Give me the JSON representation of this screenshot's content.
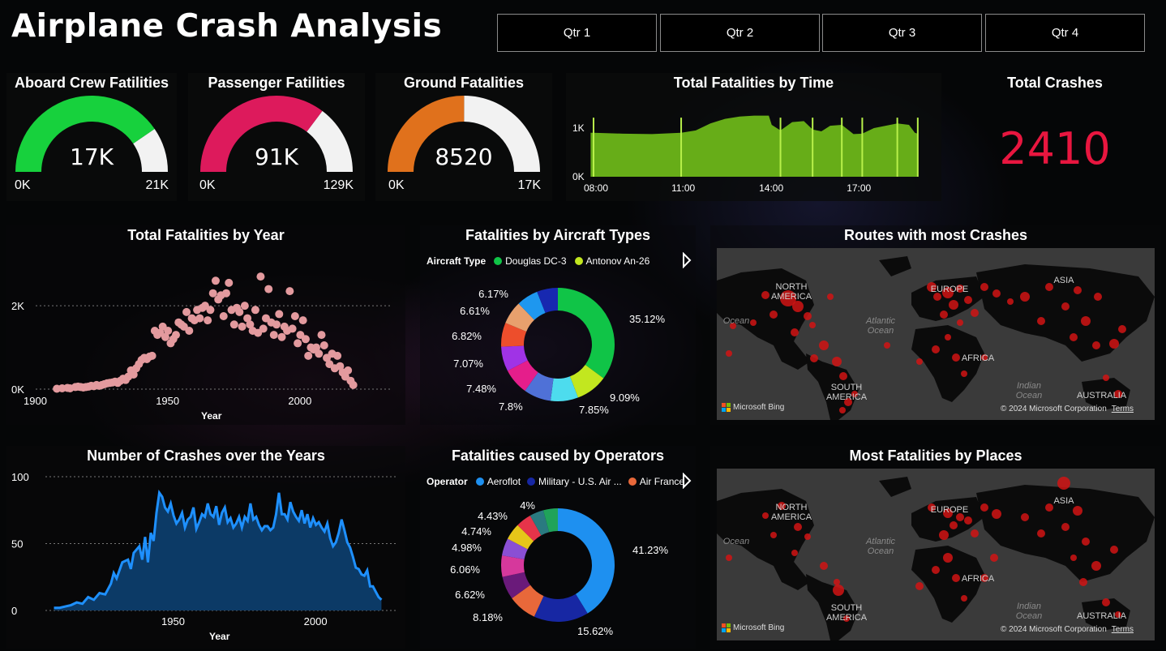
{
  "header": {
    "title": "Airplane Crash Analysis",
    "quarters": [
      "Qtr 1",
      "Qtr 2",
      "Qtr 3",
      "Qtr 4"
    ]
  },
  "gauges": [
    {
      "title": "Aboard Crew Fatilities",
      "value": 17000,
      "value_label": "17K",
      "min_label": "0K",
      "max": 21000,
      "max_label": "21K",
      "color": "#17d13d"
    },
    {
      "title": "Passenger Fatilities",
      "value": 91000,
      "value_label": "91K",
      "min_label": "0K",
      "max": 129000,
      "max_label": "129K",
      "color": "#dd1a5c"
    },
    {
      "title": "Ground Fatalities",
      "value": 8520,
      "value_label": "8520",
      "min_label": "0K",
      "max": 17000,
      "max_label": "17K",
      "color": "#e0711c"
    }
  ],
  "total_crashes": {
    "title": "Total Crashes",
    "value": "2410",
    "color": "#e8163f"
  },
  "chart_data": [
    {
      "id": "fatalities_by_time",
      "type": "area",
      "title": "Total Fatalities by Time",
      "x_ticks": [
        "08:00",
        "11:00",
        "14:00",
        "17:00"
      ],
      "y_ticks": [
        "0K",
        "1K"
      ],
      "x": [
        7.9,
        8.0,
        9.0,
        10.0,
        11.0,
        11.5,
        12.0,
        12.5,
        13.0,
        13.5,
        14.0,
        14.1,
        14.4,
        14.8,
        15.2,
        15.5,
        15.8,
        16.1,
        16.5,
        16.9,
        17.2,
        17.6,
        18.0,
        18.4,
        18.8,
        19.0,
        19.1
      ],
      "y": [
        0.95,
        0.95,
        0.93,
        0.92,
        0.95,
        1.0,
        1.15,
        1.25,
        1.3,
        1.32,
        1.32,
        1.12,
        1.0,
        1.18,
        1.2,
        1.02,
        0.98,
        1.1,
        1.12,
        0.92,
        0.93,
        1.05,
        1.1,
        1.15,
        1.12,
        0.95,
        0.93
      ],
      "ylim": [
        0,
        1.4
      ],
      "color": "#67ad18"
    },
    {
      "id": "fatalities_by_year",
      "type": "scatter",
      "title": "Total Fatalities by Year",
      "xlabel": "Year",
      "x_ticks": [
        "1900",
        "1950",
        "2000"
      ],
      "y_ticks": [
        "0K",
        "2K"
      ],
      "xlim": [
        1900,
        2025
      ],
      "ylim": [
        0,
        2.8
      ],
      "x": [
        1908,
        1910,
        1912,
        1913,
        1915,
        1916,
        1917,
        1918,
        1919,
        1920,
        1921,
        1922,
        1923,
        1924,
        1925,
        1926,
        1927,
        1928,
        1929,
        1930,
        1931,
        1932,
        1933,
        1934,
        1935,
        1936,
        1937,
        1938,
        1939,
        1940,
        1941,
        1942,
        1943,
        1944,
        1945,
        1946,
        1947,
        1948,
        1949,
        1950,
        1951,
        1952,
        1953,
        1954,
        1955,
        1956,
        1957,
        1958,
        1959,
        1960,
        1961,
        1962,
        1963,
        1964,
        1965,
        1966,
        1967,
        1968,
        1969,
        1970,
        1971,
        1972,
        1973,
        1974,
        1975,
        1976,
        1977,
        1978,
        1979,
        1980,
        1981,
        1982,
        1983,
        1984,
        1985,
        1986,
        1987,
        1988,
        1989,
        1990,
        1991,
        1992,
        1993,
        1994,
        1995,
        1996,
        1997,
        1998,
        1999,
        2000,
        2001,
        2002,
        2003,
        2004,
        2005,
        2006,
        2007,
        2008,
        2009,
        2010,
        2011,
        2012,
        2013,
        2014,
        2015,
        2016,
        2017,
        2018,
        2019,
        2020
      ],
      "y": [
        0.01,
        0.02,
        0.03,
        0.02,
        0.05,
        0.06,
        0.05,
        0.04,
        0.05,
        0.06,
        0.08,
        0.07,
        0.1,
        0.08,
        0.1,
        0.12,
        0.14,
        0.15,
        0.16,
        0.18,
        0.15,
        0.2,
        0.25,
        0.22,
        0.3,
        0.45,
        0.35,
        0.5,
        0.6,
        0.7,
        0.75,
        0.72,
        0.78,
        0.8,
        1.4,
        1.3,
        1.35,
        1.5,
        1.25,
        1.4,
        1.1,
        1.2,
        1.3,
        1.6,
        1.55,
        1.5,
        1.85,
        1.4,
        1.7,
        1.65,
        1.9,
        1.7,
        1.95,
        2.0,
        1.65,
        1.9,
        2.3,
        2.6,
        2.15,
        2.25,
        1.75,
        2.3,
        2.55,
        1.9,
        1.55,
        1.95,
        1.85,
        1.5,
        2.0,
        1.7,
        1.55,
        1.4,
        1.9,
        1.35,
        2.7,
        1.45,
        1.7,
        2.4,
        1.6,
        1.3,
        1.55,
        1.8,
        1.25,
        1.5,
        1.4,
        2.35,
        1.45,
        1.75,
        1.1,
        1.3,
        1.65,
        1.2,
        0.8,
        1.0,
        0.95,
        1.0,
        0.85,
        1.3,
        1.05,
        0.75,
        0.6,
        0.85,
        0.5,
        0.8,
        0.55,
        0.4,
        0.3,
        0.45,
        0.2,
        0.1
      ],
      "color": "#e39a9e"
    },
    {
      "id": "fatalities_by_aircraft",
      "type": "pie",
      "title": "Fatalities by Aircraft Types",
      "legend_title": "Aircraft Type",
      "legend": [
        {
          "name": "Douglas DC-3",
          "color": "#10c447"
        },
        {
          "name": "Antonov An-26",
          "color": "#c2e71f"
        }
      ],
      "values": [
        35.12,
        9.09,
        7.85,
        7.8,
        7.48,
        7.07,
        6.82,
        6.61,
        6.17
      ],
      "labels": [
        "35.12%",
        "9.09%",
        "7.85%",
        "7.8%",
        "7.48%",
        "7.07%",
        "6.82%",
        "6.61%",
        "6.17%"
      ],
      "colors": [
        "#10c447",
        "#c2e71f",
        "#4ddcee",
        "#4f71d7",
        "#e51e8b",
        "#a033e6",
        "#ed4e2c",
        "#e8a06d",
        "#1e97ef"
      ],
      "last_color": "#1728b0",
      "last_value": 5.99
    },
    {
      "id": "crashes_over_years",
      "type": "area",
      "title": "Number of Crashes over the Years",
      "xlabel": "Year",
      "x_ticks": [
        "1950",
        "2000"
      ],
      "y_ticks": [
        "0",
        "50",
        "100"
      ],
      "xlim": [
        1905,
        2028
      ],
      "ylim": [
        0,
        100
      ],
      "x": [
        1908,
        1910,
        1912,
        1914,
        1916,
        1918,
        1920,
        1922,
        1924,
        1926,
        1928,
        1929,
        1930,
        1932,
        1934,
        1935,
        1936,
        1938,
        1939,
        1940,
        1941,
        1942,
        1943,
        1944,
        1945,
        1946,
        1947,
        1948,
        1949,
        1950,
        1951,
        1952,
        1953,
        1954,
        1955,
        1956,
        1957,
        1958,
        1959,
        1960,
        1961,
        1962,
        1963,
        1964,
        1965,
        1966,
        1967,
        1968,
        1969,
        1970,
        1971,
        1972,
        1973,
        1974,
        1975,
        1976,
        1977,
        1978,
        1979,
        1980,
        1981,
        1982,
        1983,
        1984,
        1985,
        1986,
        1987,
        1988,
        1989,
        1990,
        1991,
        1992,
        1993,
        1994,
        1995,
        1996,
        1997,
        1998,
        1999,
        2000,
        2001,
        2002,
        2003,
        2004,
        2005,
        2006,
        2007,
        2008,
        2009,
        2010,
        2011,
        2012,
        2013,
        2014,
        2015,
        2016,
        2017,
        2018,
        2019,
        2020,
        2021,
        2022,
        2023
      ],
      "y": [
        2,
        2,
        3,
        4,
        6,
        5,
        10,
        8,
        13,
        12,
        20,
        28,
        24,
        36,
        38,
        31,
        43,
        48,
        38,
        55,
        36,
        58,
        52,
        73,
        88,
        85,
        77,
        74,
        80,
        71,
        65,
        68,
        73,
        62,
        68,
        70,
        77,
        61,
        66,
        72,
        70,
        80,
        72,
        70,
        78,
        64,
        73,
        77,
        66,
        69,
        62,
        65,
        70,
        62,
        70,
        67,
        80,
        68,
        70,
        64,
        60,
        63,
        63,
        60,
        62,
        72,
        88,
        72,
        72,
        68,
        81,
        74,
        70,
        67,
        75,
        65,
        72,
        62,
        69,
        64,
        66,
        62,
        59,
        65,
        54,
        48,
        51,
        58,
        68,
        60,
        51,
        47,
        40,
        32,
        31,
        27,
        26,
        30,
        18,
        18,
        14,
        10,
        8
      ],
      "color": "#1e90ff"
    },
    {
      "id": "fatalities_by_operator",
      "type": "pie",
      "title": "Fatalities caused by Operators",
      "legend_title": "Operator",
      "legend": [
        {
          "name": "Aeroflot",
          "color": "#1e90f0"
        },
        {
          "name": "Military - U.S. Air ...",
          "color": "#1727a3"
        },
        {
          "name": "Air France",
          "color": "#e8683a"
        }
      ],
      "values": [
        41.23,
        15.62,
        8.18,
        6.62,
        6.06,
        4.98,
        4.74,
        4.43,
        4,
        4.14
      ],
      "labels": [
        "41.23%",
        "15.62%",
        "8.18%",
        "6.62%",
        "6.06%",
        "4.98%",
        "4.74%",
        "4.43%",
        "4%",
        ""
      ],
      "colors": [
        "#1e90f0",
        "#1727a3",
        "#e8683a",
        "#6a1a7a",
        "#d6389c",
        "#8a4fd4",
        "#e6c619",
        "#e6344a",
        "#2a7a80",
        "#20a35a"
      ]
    }
  ],
  "maps": [
    {
      "title": "Routes with most Crashes",
      "labels": [
        "NORTH\nAMERICA",
        "EUROPE",
        "ASIA",
        "AFRICA",
        "SOUTH\nAMERICA",
        "AUSTRALIA"
      ],
      "oceans": [
        "Ocean",
        "Atlantic\nOcean",
        "Indian\nOcean"
      ],
      "bing": "Microsoft Bing",
      "copyright": "© 2024 Microsoft Corporation",
      "terms": "Terms"
    },
    {
      "title": "Most Fatalities by Places",
      "labels": [
        "NORTH\nAMERICA",
        "EUROPE",
        "ASIA",
        "AFRICA",
        "SOUTH\nAMERICA",
        "AUSTRALIA"
      ],
      "oceans": [
        "Ocean",
        "Atlantic\nOcean",
        "Indian\nOcean"
      ],
      "bing": "Microsoft Bing",
      "copyright": "© 2024 Microsoft Corporation",
      "terms": "Terms"
    }
  ]
}
